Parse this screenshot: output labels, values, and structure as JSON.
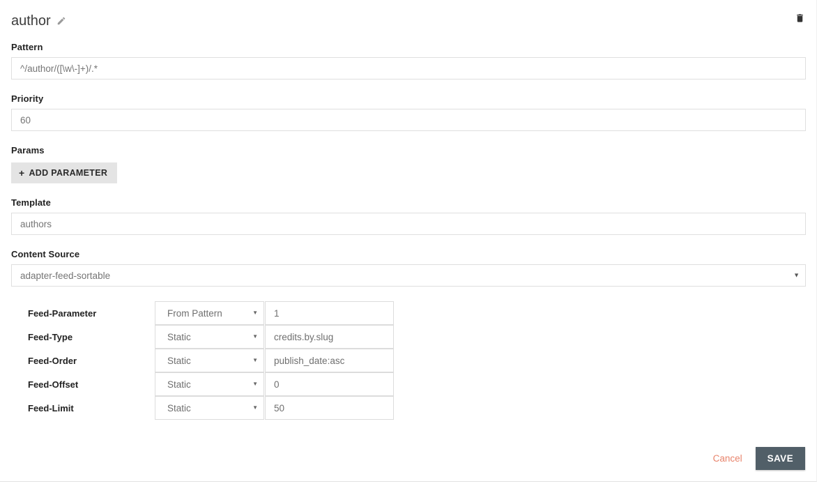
{
  "header": {
    "title": "author",
    "edit_icon": "pencil-icon",
    "delete_icon": "trash-icon"
  },
  "fields": {
    "pattern": {
      "label": "Pattern",
      "value": "^/author/([\\w\\-]+)/.*",
      "placeholder": "Pattern"
    },
    "priority": {
      "label": "Priority",
      "value": "60",
      "placeholder": "Priority"
    },
    "params": {
      "label": "Params",
      "add_button": "ADD PARAMETER",
      "add_icon": "plus-icon"
    },
    "template": {
      "label": "Template",
      "value": "authors",
      "placeholder": "Template"
    },
    "content_source": {
      "label": "Content Source",
      "value": "adapter-feed-sortable",
      "caret_icon": "chevron-down-icon"
    }
  },
  "feed_rows": [
    {
      "label": "Feed-Parameter",
      "type": "From Pattern",
      "value": "1"
    },
    {
      "label": "Feed-Type",
      "type": "Static",
      "value": "credits.by.slug"
    },
    {
      "label": "Feed-Order",
      "type": "Static",
      "value": "publish_date:asc"
    },
    {
      "label": "Feed-Offset",
      "type": "Static",
      "value": "0"
    },
    {
      "label": "Feed-Limit",
      "type": "Static",
      "value": "50"
    }
  ],
  "select_options": [
    "Static",
    "From Pattern"
  ],
  "footer": {
    "cancel_label": "Cancel",
    "save_label": "SAVE"
  },
  "colors": {
    "accent_cancel": "#e8836b",
    "save_button": "#515f68",
    "field_border": "#dfdfdf",
    "add_button_bg": "#e4e4e4"
  }
}
